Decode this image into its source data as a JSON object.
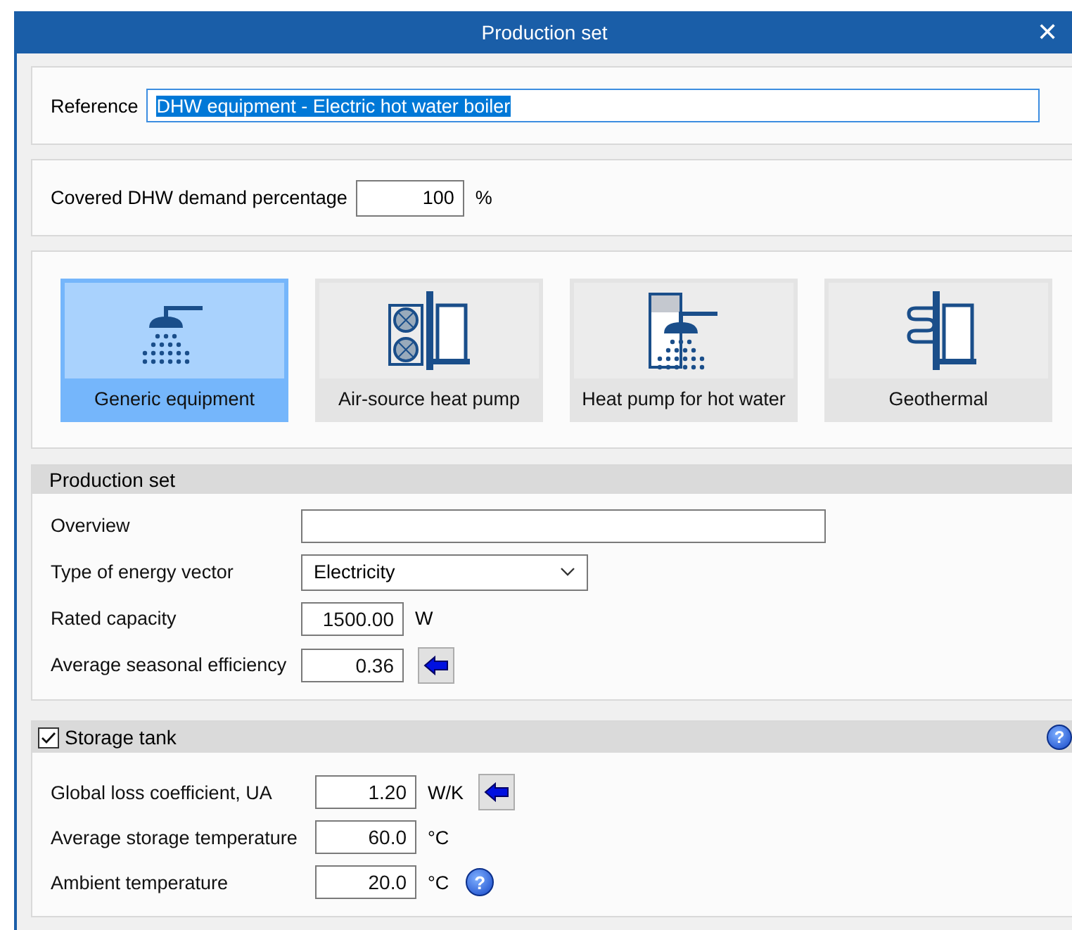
{
  "window": {
    "title": "Production set",
    "close": "✕"
  },
  "reference": {
    "label": "Reference",
    "value": "DHW equipment - Electric hot water boiler",
    "selected": true
  },
  "coverage": {
    "label": "Covered DHW demand percentage",
    "value": "100",
    "unit": "%"
  },
  "equipment": [
    {
      "label": "Generic equipment",
      "kind": "shower",
      "selected": true
    },
    {
      "label": "Air-source heat pump",
      "kind": "airsource",
      "selected": false
    },
    {
      "label": "Heat pump for hot water",
      "kind": "tankshower",
      "selected": false
    },
    {
      "label": "Geothermal",
      "kind": "geothermal",
      "selected": false
    }
  ],
  "production_set": {
    "title": "Production set",
    "rows": [
      {
        "kind": "text",
        "label": "Overview"
      },
      {
        "kind": "select",
        "label": "Type of energy vector",
        "value": "Electricity"
      },
      {
        "kind": "number",
        "label": "Rated capacity",
        "value": "1500.00",
        "unit": "W"
      },
      {
        "kind": "number_arrow",
        "label": "Average seasonal efficiency",
        "value": "0.36"
      }
    ]
  },
  "storage_tank": {
    "title": "Storage tank",
    "checked": true,
    "help": "?",
    "rows": [
      {
        "kind": "number_arrow",
        "label": "Global loss coefficient, UA",
        "value": "1.20",
        "unit": "W/K"
      },
      {
        "kind": "number",
        "label": "Average storage temperature",
        "value": "60.0",
        "unit": "°C"
      },
      {
        "kind": "number_help",
        "label": "Ambient temperature",
        "value": "20.0",
        "unit": "°C",
        "help": "?"
      }
    ]
  }
}
